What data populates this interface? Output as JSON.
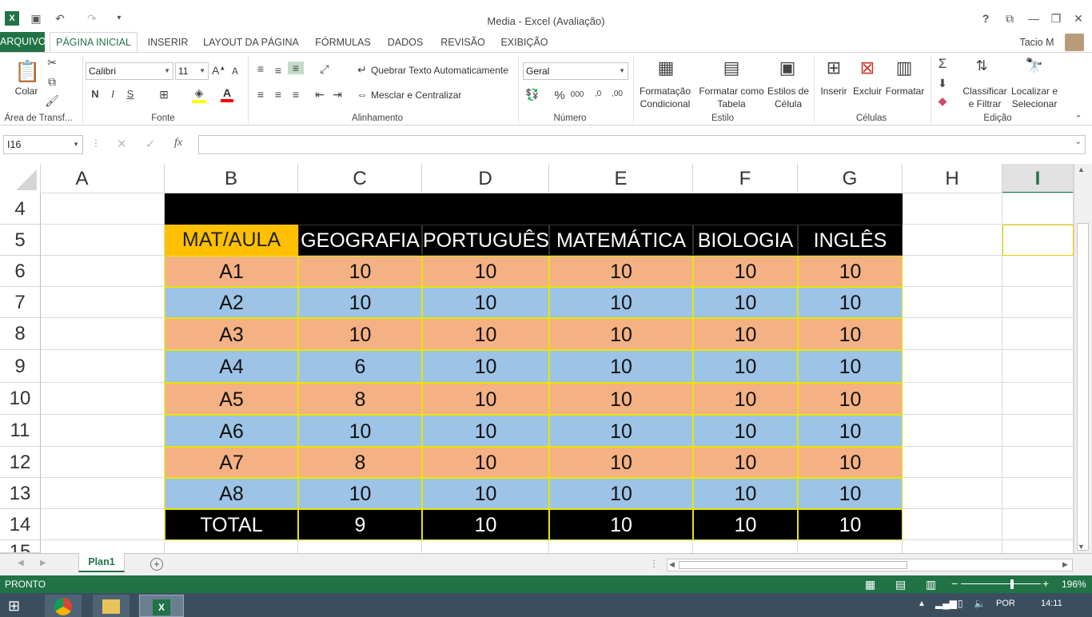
{
  "window": {
    "title": "Media - Excel (Avaliação)",
    "user": "Tacio M"
  },
  "tabs": [
    "ARQUIVO",
    "PÁGINA INICIAL",
    "INSERIR",
    "LAYOUT DA PÁGINA",
    "FÓRMULAS",
    "DADOS",
    "REVISÃO",
    "EXIBIÇÃO"
  ],
  "ribbon": {
    "paste_label": "Colar",
    "font_name": "Calibri",
    "font_size": "11",
    "bold": "N",
    "italic": "I",
    "underline": "S",
    "wrap_text": "Quebrar Texto Automaticamente",
    "merge_center": "Mesclar e Centralizar",
    "number_format": "Geral",
    "cond_format_1": "Formatação",
    "cond_format_2": "Condicional",
    "format_table_1": "Formatar como",
    "format_table_2": "Tabela",
    "cell_styles_1": "Estilos de",
    "cell_styles_2": "Célula",
    "insert": "Inserir",
    "delete": "Excluir",
    "format": "Formatar",
    "sort_1": "Classificar",
    "sort_2": "e Filtrar",
    "find_1": "Localizar e",
    "find_2": "Selecionar",
    "groups": {
      "clipboard": "Área de Transf...",
      "font": "Fonte",
      "alignment": "Alinhamento",
      "number": "Número",
      "style": "Estilo",
      "cells": "Células",
      "editing": "Edição"
    }
  },
  "formula_bar": {
    "name_box": "I16",
    "fx": "fx",
    "value": ""
  },
  "columns": [
    "A",
    "B",
    "C",
    "D",
    "E",
    "F",
    "G",
    "H",
    "I"
  ],
  "rows": [
    "4",
    "5",
    "6",
    "7",
    "8",
    "9",
    "10",
    "11",
    "12",
    "13",
    "14"
  ],
  "table": {
    "header": [
      "MAT/AULA",
      "GEOGRAFIA",
      "PORTUGUÊS",
      "MATEMÁTICA",
      "BIOLOGIA",
      "INGLÊS"
    ],
    "body": [
      [
        "A1",
        "10",
        "10",
        "10",
        "10",
        "10"
      ],
      [
        "A2",
        "10",
        "10",
        "10",
        "10",
        "10"
      ],
      [
        "A3",
        "10",
        "10",
        "10",
        "10",
        "10"
      ],
      [
        "A4",
        "6",
        "10",
        "10",
        "10",
        "10"
      ],
      [
        "A5",
        "8",
        "10",
        "10",
        "10",
        "10"
      ],
      [
        "A6",
        "10",
        "10",
        "10",
        "10",
        "10"
      ],
      [
        "A7",
        "8",
        "10",
        "10",
        "10",
        "10"
      ],
      [
        "A8",
        "10",
        "10",
        "10",
        "10",
        "10"
      ]
    ],
    "total": [
      "TOTAL",
      "9",
      "10",
      "10",
      "10",
      "10"
    ]
  },
  "colors": {
    "orange": "#f4b183",
    "blue": "#9dc3e6",
    "header_first": "#ffc000",
    "accent": "#217346"
  },
  "sheet_tab": "Plan1",
  "status": {
    "ready": "PRONTO",
    "zoom": "196%"
  },
  "taskbar": {
    "lang": "POR",
    "time": "14:11"
  }
}
